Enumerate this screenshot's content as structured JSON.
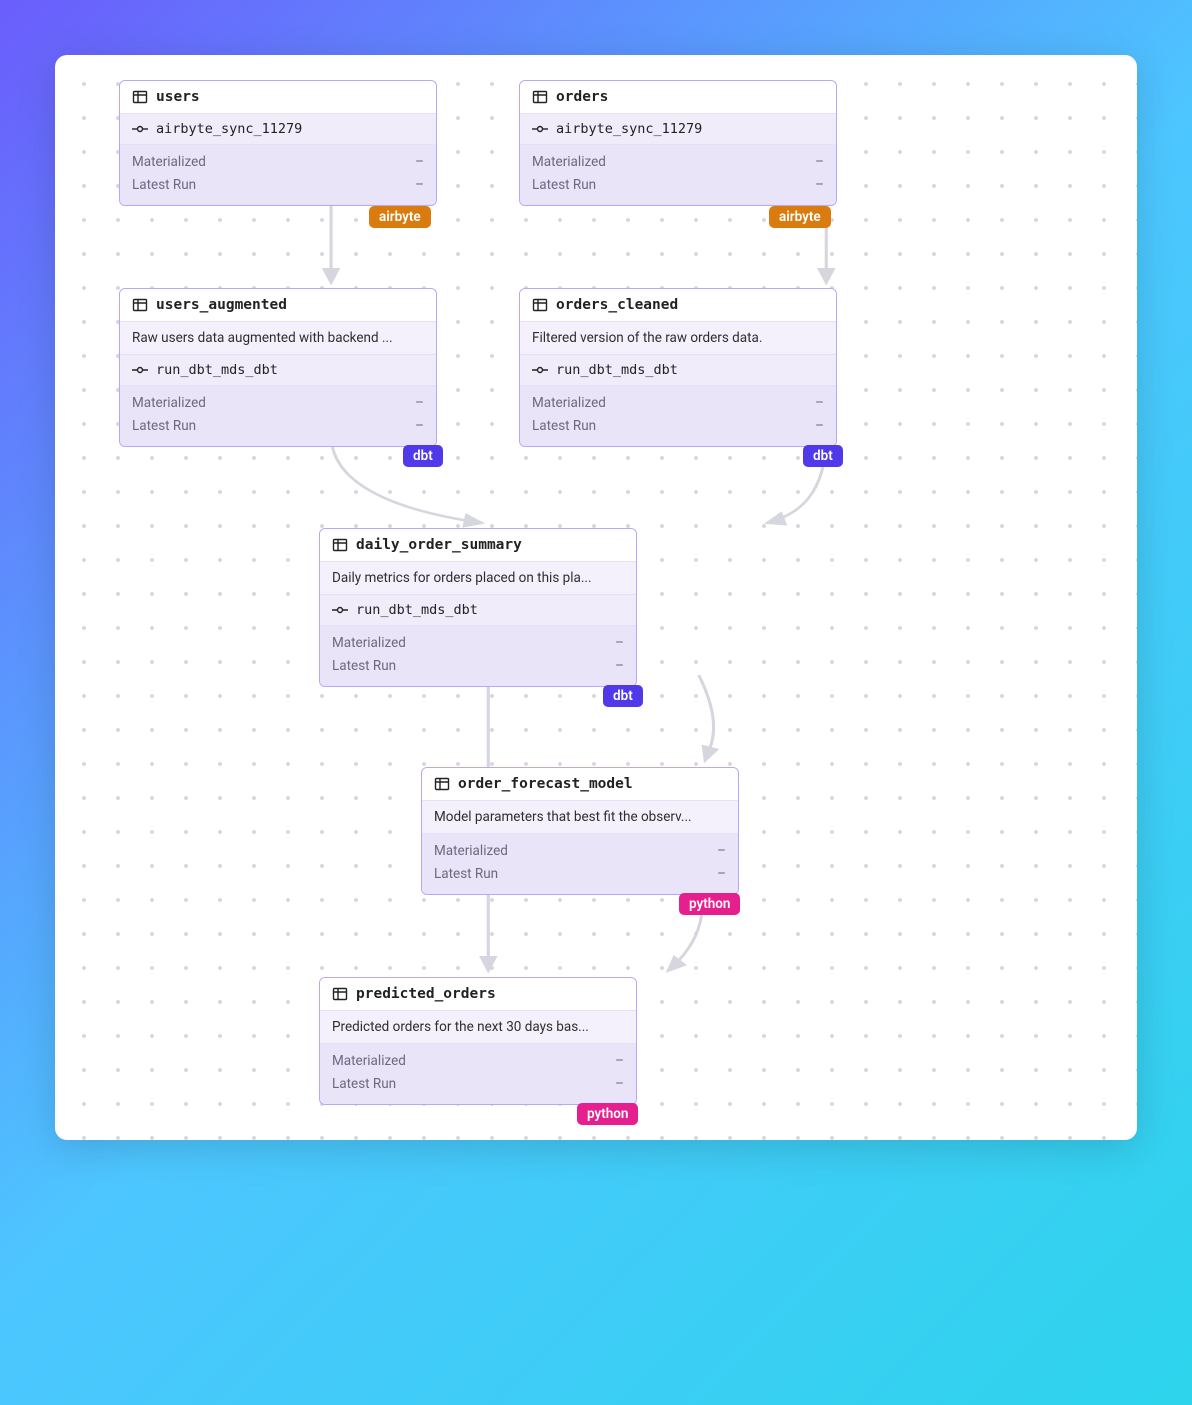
{
  "labels": {
    "materialized": "Materialized",
    "latest_run": "Latest Run",
    "dash": "–"
  },
  "badges": {
    "airbyte": "airbyte",
    "dbt": "dbt",
    "python": "python"
  },
  "nodes": {
    "users": {
      "title": "users",
      "run": "airbyte_sync_11279"
    },
    "orders": {
      "title": "orders",
      "run": "airbyte_sync_11279"
    },
    "users_augmented": {
      "title": "users_augmented",
      "desc": "Raw users data augmented with backend ...",
      "run": "run_dbt_mds_dbt"
    },
    "orders_cleaned": {
      "title": "orders_cleaned",
      "desc": "Filtered version of the raw orders data.",
      "run": "run_dbt_mds_dbt"
    },
    "daily_order_summary": {
      "title": "daily_order_summary",
      "desc": "Daily metrics for orders placed on this pla...",
      "run": "run_dbt_mds_dbt"
    },
    "order_forecast_model": {
      "title": "order_forecast_model",
      "desc": "Model parameters that best fit the observ..."
    },
    "predicted_orders": {
      "title": "predicted_orders",
      "desc": "Predicted orders for the next 30 days bas..."
    }
  }
}
